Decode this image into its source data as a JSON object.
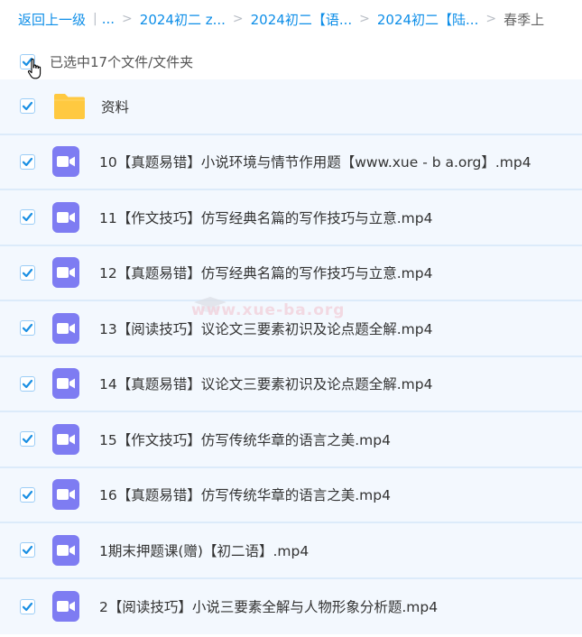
{
  "breadcrumb": {
    "back": "返回上一级",
    "ellipsis": "...",
    "items": [
      "2024初二 z...",
      "2024初二【语...",
      "2024初二【陆..."
    ],
    "current": "春季上"
  },
  "selection": {
    "text": "已选中17个文件/文件夹",
    "checked": true
  },
  "files": [
    {
      "name": "资料",
      "type": "folder",
      "checked": true
    },
    {
      "name": "10【真题易错】小说环境与情节作用题【www.xue - b a.org】.mp4",
      "type": "video",
      "checked": true
    },
    {
      "name": "11【作文技巧】仿写经典名篇的写作技巧与立意.mp4",
      "type": "video",
      "checked": true
    },
    {
      "name": "12【真题易错】仿写经典名篇的写作技巧与立意.mp4",
      "type": "video",
      "checked": true
    },
    {
      "name": "13【阅读技巧】议论文三要素初识及论点题全解.mp4",
      "type": "video",
      "checked": true
    },
    {
      "name": "14【真题易错】议论文三要素初识及论点题全解.mp4",
      "type": "video",
      "checked": true
    },
    {
      "name": "15【作文技巧】仿写传统华章的语言之美.mp4",
      "type": "video",
      "checked": true
    },
    {
      "name": "16【真题易错】仿写传统华章的语言之美.mp4",
      "type": "video",
      "checked": true
    },
    {
      "name": "1期末押题课(赠)【初二语】.mp4",
      "type": "video",
      "checked": true
    },
    {
      "name": "2【阅读技巧】小说三要素全解与人物形象分析题.mp4",
      "type": "video",
      "checked": true
    }
  ],
  "watermark": "www.xue-ba.org",
  "colors": {
    "link": "#0d8ee8",
    "video_icon": "#7e7cf2",
    "folder": "#ffc940",
    "row_bg": "#f3f8fe",
    "check": "#1a8fe3"
  }
}
